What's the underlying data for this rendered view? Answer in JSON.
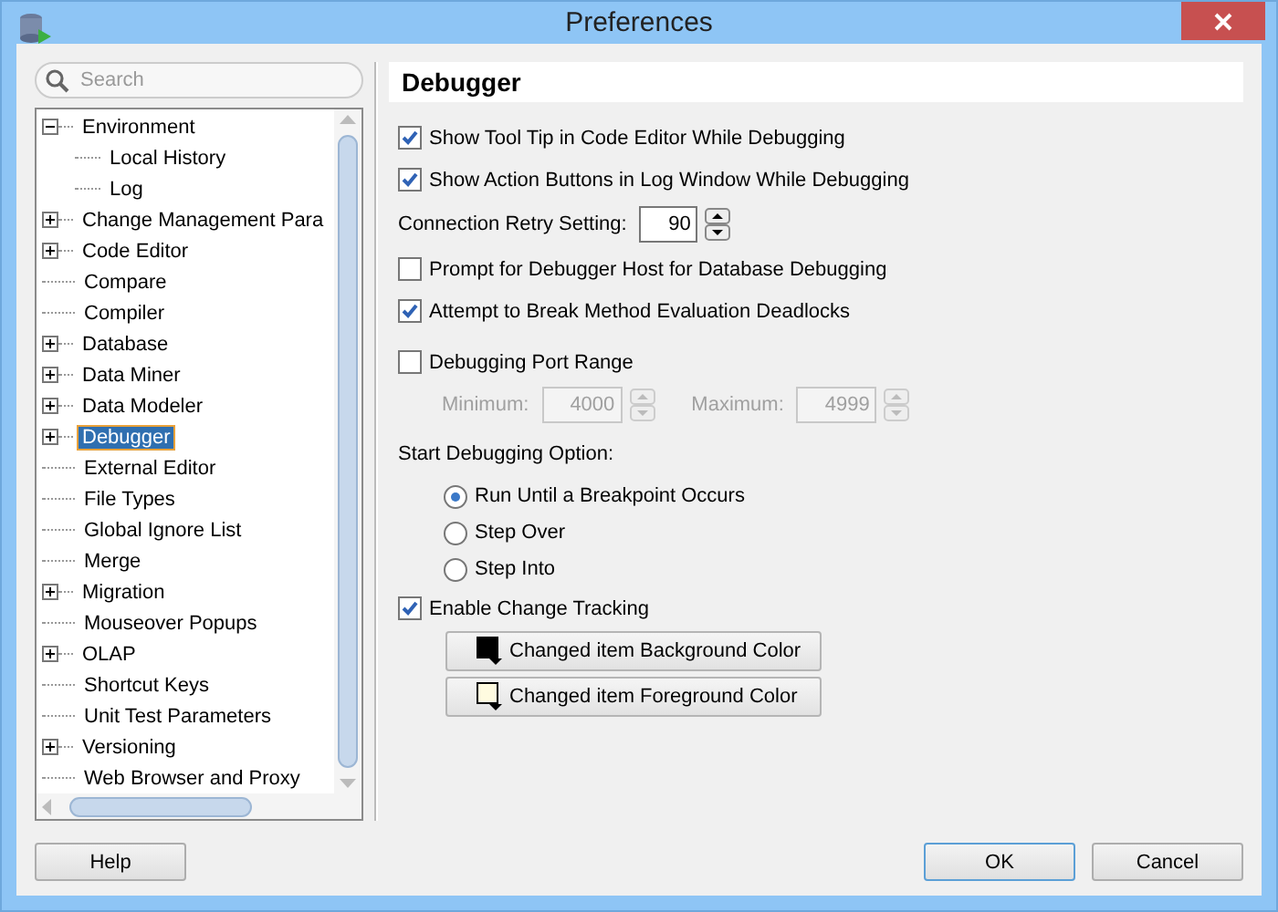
{
  "window": {
    "title": "Preferences"
  },
  "search": {
    "placeholder": "Search"
  },
  "tree": [
    {
      "label": "Environment",
      "kind": "node",
      "expanded": true,
      "selected": false,
      "children": [
        {
          "label": "Local History",
          "kind": "leaf",
          "selected": false
        },
        {
          "label": "Log",
          "kind": "leaf",
          "selected": false
        }
      ]
    },
    {
      "label": "Change Management Para",
      "kind": "node",
      "expanded": false,
      "selected": false
    },
    {
      "label": "Code Editor",
      "kind": "node",
      "expanded": false,
      "selected": false
    },
    {
      "label": "Compare",
      "kind": "leaf",
      "selected": false
    },
    {
      "label": "Compiler",
      "kind": "leaf",
      "selected": false
    },
    {
      "label": "Database",
      "kind": "node",
      "expanded": false,
      "selected": false
    },
    {
      "label": "Data Miner",
      "kind": "node",
      "expanded": false,
      "selected": false
    },
    {
      "label": "Data Modeler",
      "kind": "node",
      "expanded": false,
      "selected": false
    },
    {
      "label": "Debugger",
      "kind": "node",
      "expanded": false,
      "selected": true
    },
    {
      "label": "External Editor",
      "kind": "leaf",
      "selected": false
    },
    {
      "label": "File Types",
      "kind": "leaf",
      "selected": false
    },
    {
      "label": "Global Ignore List",
      "kind": "leaf",
      "selected": false
    },
    {
      "label": "Merge",
      "kind": "leaf",
      "selected": false
    },
    {
      "label": "Migration",
      "kind": "node",
      "expanded": false,
      "selected": false
    },
    {
      "label": "Mouseover Popups",
      "kind": "leaf",
      "selected": false
    },
    {
      "label": "OLAP",
      "kind": "node",
      "expanded": false,
      "selected": false
    },
    {
      "label": "Shortcut Keys",
      "kind": "leaf",
      "selected": false
    },
    {
      "label": "Unit Test Parameters",
      "kind": "leaf",
      "selected": false
    },
    {
      "label": "Versioning",
      "kind": "node",
      "expanded": false,
      "selected": false
    },
    {
      "label": "Web Browser and Proxy",
      "kind": "leaf",
      "selected": false
    }
  ],
  "panel": {
    "title": "Debugger"
  },
  "settings": [
    {
      "kind": "checkbox",
      "label": "Show Tool Tip in Code Editor While Debugging",
      "checked": true,
      "disabled": false
    },
    {
      "kind": "checkbox",
      "label": "Show Action Buttons in Log Window While Debugging",
      "checked": true,
      "disabled": false
    },
    {
      "kind": "spinner",
      "label": "Connection Retry Setting:",
      "value": "90",
      "disabled": false
    },
    {
      "kind": "checkbox",
      "label": "Prompt for Debugger Host for Database Debugging",
      "checked": false,
      "disabled": false
    },
    {
      "kind": "checkbox",
      "label": "Attempt to Break Method Evaluation Deadlocks",
      "checked": true,
      "disabled": false
    },
    {
      "kind": "checkbox",
      "label": "Debugging Port Range",
      "checked": false,
      "disabled": false
    },
    {
      "kind": "range",
      "disabled": true,
      "min_label": "Minimum:",
      "min_value": "4000",
      "max_label": "Maximum:",
      "max_value": "4999"
    },
    {
      "kind": "heading",
      "label": "Start Debugging Option:"
    },
    {
      "kind": "radio",
      "label": "Run Until a Breakpoint Occurs",
      "selected": true
    },
    {
      "kind": "radio",
      "label": "Step Over",
      "selected": false
    },
    {
      "kind": "radio",
      "label": "Step Into",
      "selected": false
    },
    {
      "kind": "checkbox",
      "label": "Enable Change Tracking",
      "checked": true,
      "disabled": false
    },
    {
      "kind": "color_button",
      "label": "Changed item Background Color",
      "color": "#000000"
    },
    {
      "kind": "color_button",
      "label": "Changed item Foreground Color",
      "color": "#fffbe0"
    }
  ],
  "buttons": {
    "help": "Help",
    "ok": "OK",
    "cancel": "Cancel"
  }
}
